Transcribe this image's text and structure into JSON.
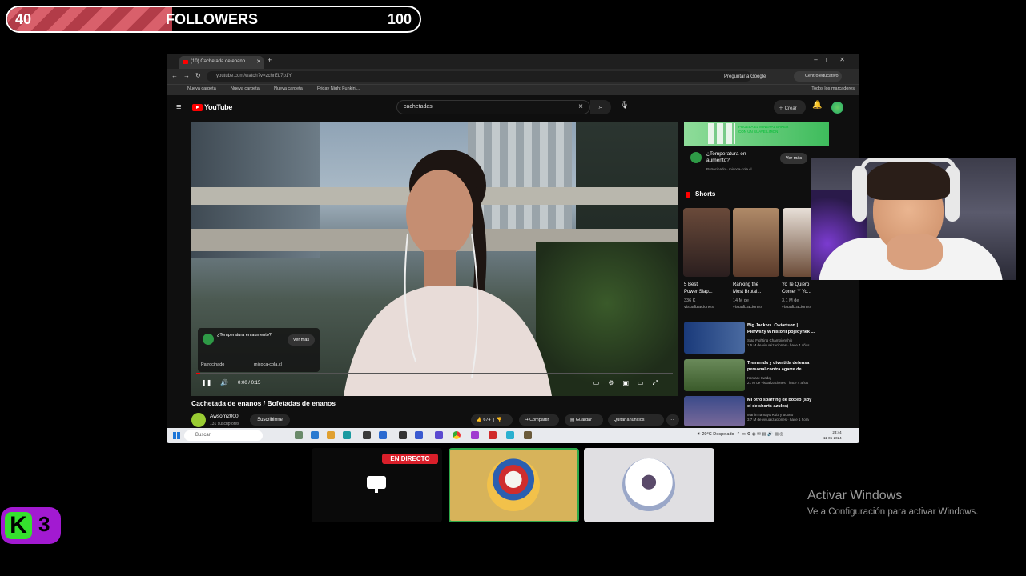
{
  "followers_bar": {
    "current": "40",
    "label": "FOLLOWERS",
    "goal": "100",
    "progress_fraction": 0.4
  },
  "browser": {
    "tab_title": "(10) Cachetada de enano...",
    "url": "youtube.com/watch?v=zchrEL7p1Y",
    "google_search": "Preguntar a Google",
    "profile": "Centro educativo",
    "bookmarks": [
      "Nueva carpeta",
      "Nueva carpeta",
      "Nueva carpeta",
      "Friday Night Funkin'..."
    ],
    "all_bookmarks": "Todos los marcadores"
  },
  "youtube": {
    "brand": "YouTube",
    "search_query": "cachetadas",
    "create_label": "Crear",
    "notification_count": "9+",
    "video_ad": {
      "title": "¿Temperatura en aumento?",
      "cta": "Ver más",
      "sponsored": "Patrocinado",
      "domain": "micoca-cola.cl"
    },
    "player": {
      "time": "0:00 / 0:15"
    },
    "video_title": "Cachetada de enanos / Bofetadas de enanos",
    "channel_name": "Awsom2000",
    "channel_subs": "131 suscriptores",
    "subscribe_label": "Suscribirme",
    "likes": "674",
    "share_label": "Compartir",
    "save_label": "Guardar",
    "remove_ads_label": "Quitar anuncios",
    "sidebar_banner": {
      "text1": "PRUEBA EL MINERAL BAKER",
      "text2": "CON UN SUAVE LIMÓN"
    },
    "sidebar_ad": {
      "title_line1": "¿Temperatura en",
      "title_line2": "aumento?",
      "sponsored": "Patrocinado · micoca-cola.cl",
      "cta": "Ver más"
    },
    "shorts_heading": "Shorts",
    "shorts": [
      {
        "title_line1": "5 Best",
        "title_line2": "Power Slap...",
        "views_line1": "336 K",
        "views_line2": "visualizaciones"
      },
      {
        "title_line1": "Ranking the",
        "title_line2": "Most Brutal...",
        "views_line1": "14 M de",
        "views_line2": "visualizaciones"
      },
      {
        "title_line1": "Yo Te Quiero",
        "title_line2": "Comer Y Yo...",
        "views_line1": "3,1 M de",
        "views_line2": "visualizaciones"
      }
    ],
    "recommended": [
      {
        "title_line1": "Big Jack vs. Cwiartson |",
        "title_line2": "Pierwszy w historii pojedynek ...",
        "channel": "Slap Fighting Championship",
        "meta": "1,5 M de visualizaciones · hace 4 años"
      },
      {
        "title_line1": "Tremenda y divertida defensa",
        "title_line2": "personal contra agarre de ...",
        "channel": "Kontarx Iwadq",
        "meta": "21 M de visualizaciones · hace 4 años"
      },
      {
        "title_line1": "Mi otro sparring de boxeo (soy",
        "title_line2": "el de shorts azules)",
        "channel": "Martin Tamayo Ruiz y Boxeo",
        "meta": "3,7 M de visualizaciones · hace 1 hora"
      }
    ]
  },
  "taskbar": {
    "search_placeholder": "Buscar",
    "weather": "20°C Despejado",
    "time": "23:44",
    "date": "11-05-2024"
  },
  "call": {
    "live_label": "EN DIRECTO"
  },
  "watermark": {
    "line1": "Activar Windows",
    "line2": "Ve a Configuración para activar Windows."
  },
  "badge": {
    "letter": "K",
    "number": "3"
  },
  "colors": {
    "bar_fill": "#d9606b",
    "live_red": "#d91f2a",
    "badge_purple": "#a21ad1",
    "badge_green": "#35e02e"
  }
}
